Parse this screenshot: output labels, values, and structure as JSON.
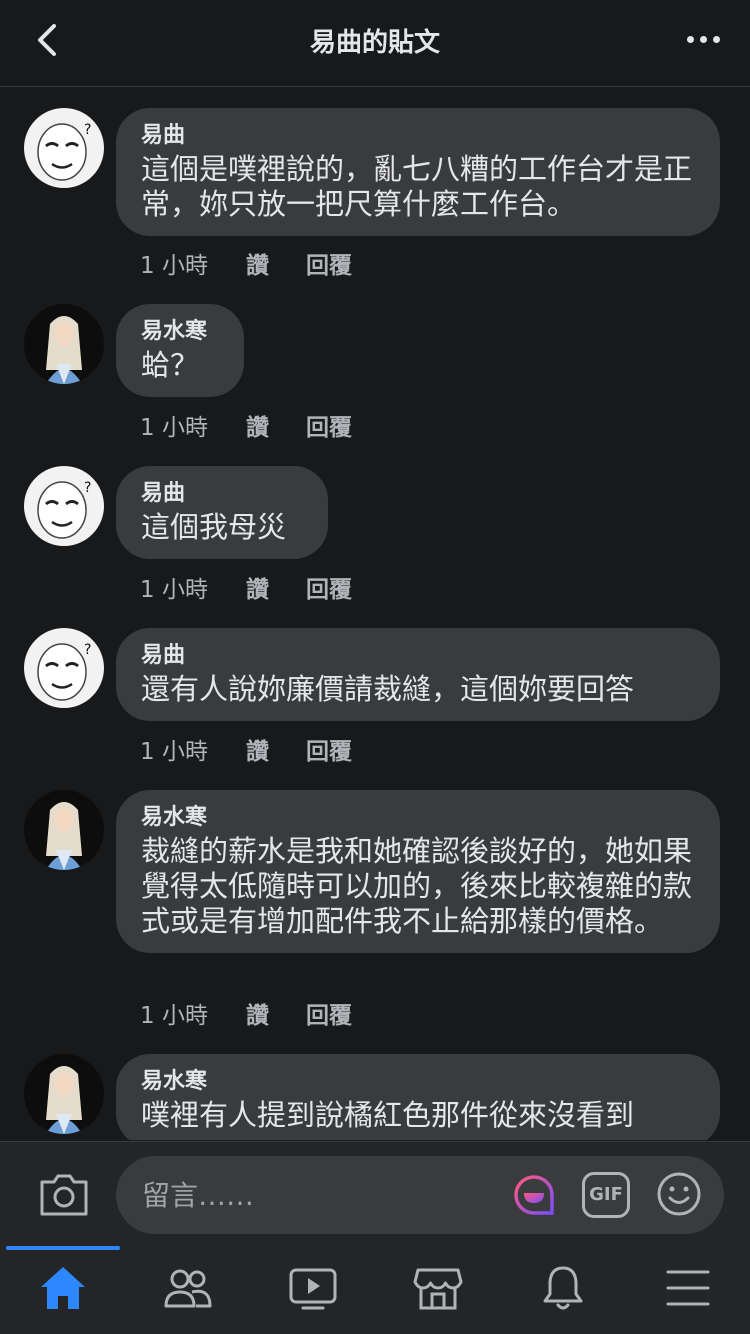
{
  "header": {
    "title": "易曲的貼文"
  },
  "comments": [
    {
      "author": "易曲",
      "text": "這個是噗裡說的，亂七八糟的工作台才是正常，妳只放一把尺算什麼工作台。",
      "time": "1 小時",
      "like": "讚",
      "reply": "回覆",
      "avatar": "meme-face"
    },
    {
      "author": "易水寒",
      "text": "蛤？",
      "time": "1 小時",
      "like": "讚",
      "reply": "回覆",
      "avatar": "white-hair-woman"
    },
    {
      "author": "易曲",
      "text": "這個我母災",
      "time": "1 小時",
      "like": "讚",
      "reply": "回覆",
      "avatar": "meme-face"
    },
    {
      "author": "易曲",
      "text": "還有人說妳廉價請裁縫，這個妳要回答",
      "time": "1 小時",
      "like": "讚",
      "reply": "回覆",
      "avatar": "meme-face"
    },
    {
      "author": "易水寒",
      "text": "裁縫的薪水是我和她確認後談好的，她如果覺得太低隨時可以加的，後來比較複雜的款式或是有增加配件我不止給那樣的價格。",
      "time": "1 小時",
      "like": "讚",
      "reply": "回覆",
      "avatar": "white-hair-woman"
    },
    {
      "author": "易水寒",
      "text": "噗裡有人提到說橘紅色那件從來沒看到",
      "avatar": "white-hair-woman"
    }
  ],
  "composer": {
    "placeholder": "留言……",
    "gif_label": "GIF"
  },
  "colors": {
    "accent": "#2d88ff",
    "bubble": "#3a3b3c",
    "background": "#18191a"
  },
  "tabs": [
    "home-icon",
    "friends-icon",
    "watch-icon",
    "marketplace-icon",
    "notifications-icon",
    "menu-icon"
  ]
}
